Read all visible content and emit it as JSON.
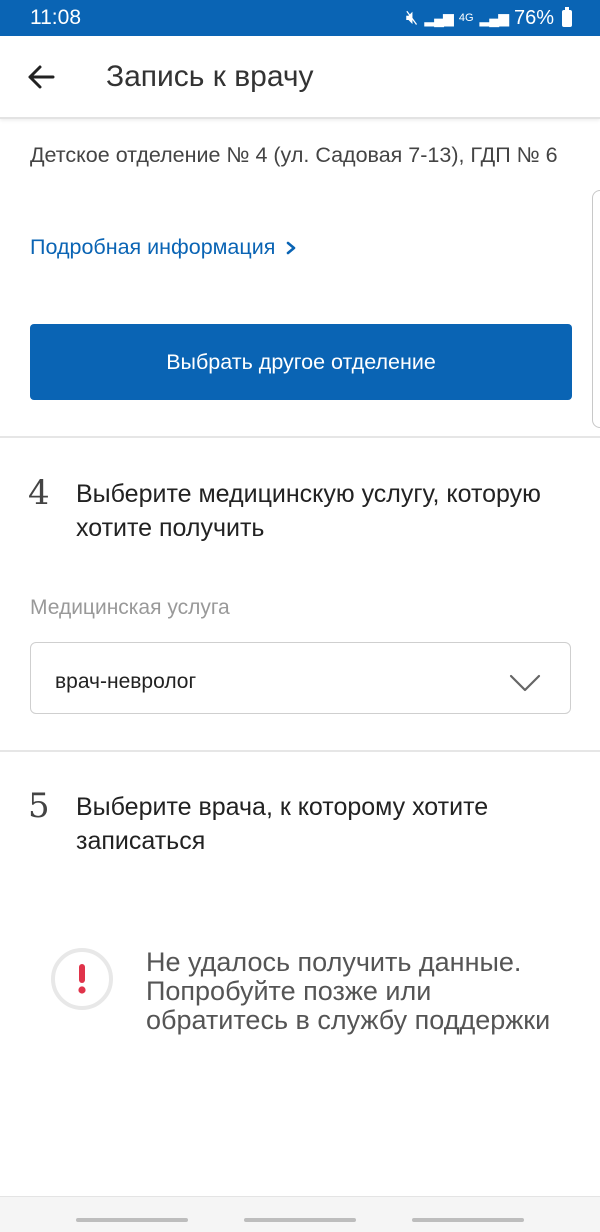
{
  "status_bar": {
    "time": "11:08",
    "network": "4G",
    "battery": "76%",
    "icons": [
      "mute-icon",
      "signal-icon",
      "signal-icon",
      "battery-icon"
    ]
  },
  "app_bar": {
    "back_icon": "arrow-left-icon",
    "title": "Запись к врачу"
  },
  "clinic": {
    "address": "Детское отделение № 4 (ул. Садовая 7-13), ГДП № 6",
    "details_link": "Подробная информация",
    "change_button": "Выбрать другое отделение"
  },
  "step4": {
    "number": "4",
    "title": "Выберите медицинскую услугу, которую хотите получить",
    "field_label": "Медицинская услуга",
    "selected_value": "врач-невролог"
  },
  "step5": {
    "number": "5",
    "title": "Выберите врача, к которому хотите записаться",
    "error_message": "Не удалось получить данные. Попробуйте позже или обратитесь в службу поддержки",
    "error_icon": "exclamation-icon"
  },
  "colors": {
    "primary": "#0a64b4",
    "error": "#e0334a"
  }
}
